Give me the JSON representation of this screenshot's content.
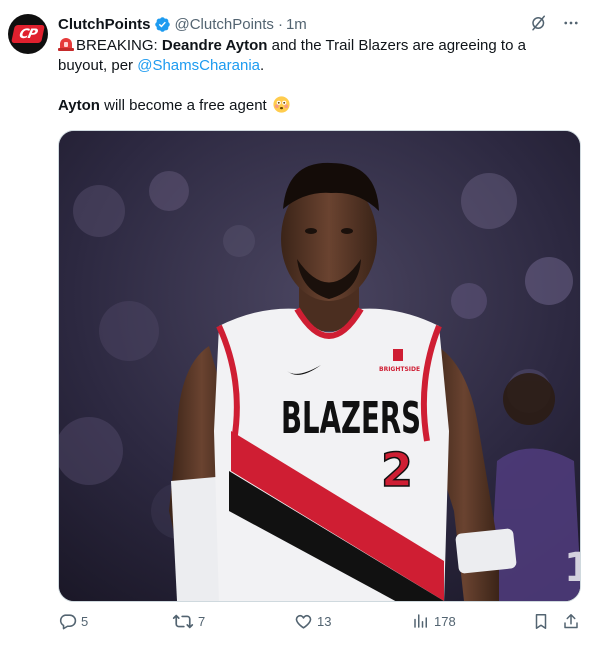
{
  "tweet": {
    "author_name": "ClutchPoints",
    "handle": "@ClutchPoints",
    "separator": "·",
    "time": "1m",
    "avatar_text": "CP",
    "text": {
      "p1_prefix": "BREAKING: ",
      "p1_bold": "Deandre Ayton",
      "p1_mid": " and the Trail Blazers are agreeing to a buyout, per ",
      "p1_mention": "@ShamsCharania",
      "p1_end": ".",
      "p2_bold": "Ayton",
      "p2_rest": " will become a free agent"
    },
    "image": {
      "jersey_text": "BLAZERS",
      "jersey_number": "2",
      "patch_text": "BRIGHTSIDE"
    },
    "metrics": {
      "replies": "5",
      "retweets": "7",
      "likes": "13",
      "views": "178"
    }
  },
  "colors": {
    "accent": "#1d9bf0",
    "secondary_text": "#536471",
    "brand_red": "#e0202e",
    "jersey_red": "#cf1e33"
  }
}
